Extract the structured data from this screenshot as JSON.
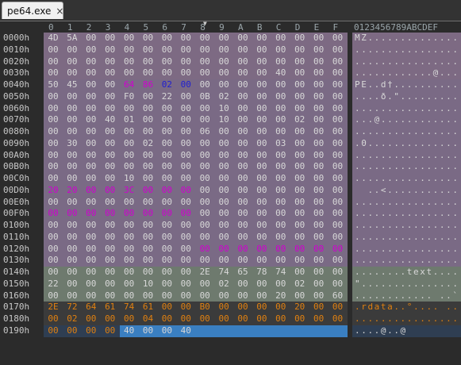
{
  "tab": {
    "title": "pe64.exe",
    "close_glyph": "×"
  },
  "column_headers": [
    "0",
    "1",
    "2",
    "3",
    "4",
    "5",
    "6",
    "7",
    "8",
    "9",
    "A",
    "B",
    "C",
    "D",
    "E",
    "F"
  ],
  "ascii_header": "0123456789ABCDEF",
  "marker_glyph": "▼",
  "offsets": [
    "0000h",
    "0010h",
    "0020h",
    "0030h",
    "0040h",
    "0050h",
    "0060h",
    "0070h",
    "0080h",
    "0090h",
    "00A0h",
    "00B0h",
    "00C0h",
    "00D0h",
    "00E0h",
    "00F0h",
    "0100h",
    "0110h",
    "0120h",
    "0130h",
    "0140h",
    "0150h",
    "0160h",
    "0170h",
    "0180h",
    "0190h"
  ],
  "rows": [
    [
      "4D",
      "5A",
      "00",
      "00",
      "00",
      "00",
      "00",
      "00",
      "00",
      "00",
      "00",
      "00",
      "00",
      "00",
      "00",
      "00"
    ],
    [
      "00",
      "00",
      "00",
      "00",
      "00",
      "00",
      "00",
      "00",
      "00",
      "00",
      "00",
      "00",
      "00",
      "00",
      "00",
      "00"
    ],
    [
      "00",
      "00",
      "00",
      "00",
      "00",
      "00",
      "00",
      "00",
      "00",
      "00",
      "00",
      "00",
      "00",
      "00",
      "00",
      "00"
    ],
    [
      "00",
      "00",
      "00",
      "00",
      "00",
      "00",
      "00",
      "00",
      "00",
      "00",
      "00",
      "00",
      "40",
      "00",
      "00",
      "00"
    ],
    [
      "50",
      "45",
      "00",
      "00",
      "64",
      "86",
      "02",
      "00",
      "00",
      "00",
      "00",
      "00",
      "00",
      "00",
      "00",
      "00"
    ],
    [
      "00",
      "00",
      "00",
      "00",
      "F0",
      "00",
      "22",
      "00",
      "0B",
      "02",
      "00",
      "00",
      "00",
      "00",
      "00",
      "00"
    ],
    [
      "00",
      "00",
      "00",
      "00",
      "00",
      "00",
      "00",
      "00",
      "00",
      "10",
      "00",
      "00",
      "00",
      "00",
      "00",
      "00"
    ],
    [
      "00",
      "00",
      "00",
      "40",
      "01",
      "00",
      "00",
      "00",
      "00",
      "10",
      "00",
      "00",
      "00",
      "02",
      "00",
      "00"
    ],
    [
      "00",
      "00",
      "00",
      "00",
      "00",
      "00",
      "00",
      "00",
      "06",
      "00",
      "00",
      "00",
      "00",
      "00",
      "00",
      "00"
    ],
    [
      "00",
      "30",
      "00",
      "00",
      "00",
      "02",
      "00",
      "00",
      "00",
      "00",
      "00",
      "00",
      "03",
      "00",
      "00",
      "00"
    ],
    [
      "00",
      "00",
      "00",
      "00",
      "00",
      "00",
      "00",
      "00",
      "00",
      "00",
      "00",
      "00",
      "00",
      "00",
      "00",
      "00"
    ],
    [
      "00",
      "00",
      "00",
      "00",
      "00",
      "00",
      "00",
      "00",
      "00",
      "00",
      "00",
      "00",
      "00",
      "00",
      "00",
      "00"
    ],
    [
      "00",
      "00",
      "00",
      "00",
      "10",
      "00",
      "00",
      "00",
      "00",
      "00",
      "00",
      "00",
      "00",
      "00",
      "00",
      "00"
    ],
    [
      "20",
      "20",
      "00",
      "00",
      "3C",
      "00",
      "00",
      "00",
      "00",
      "00",
      "00",
      "00",
      "00",
      "00",
      "00",
      "00"
    ],
    [
      "00",
      "00",
      "00",
      "00",
      "00",
      "00",
      "00",
      "00",
      "00",
      "00",
      "00",
      "00",
      "00",
      "00",
      "00",
      "00"
    ],
    [
      "00",
      "00",
      "00",
      "00",
      "00",
      "00",
      "00",
      "00",
      "00",
      "00",
      "00",
      "00",
      "00",
      "00",
      "00",
      "00"
    ],
    [
      "00",
      "00",
      "00",
      "00",
      "00",
      "00",
      "00",
      "00",
      "00",
      "00",
      "00",
      "00",
      "00",
      "00",
      "00",
      "00"
    ],
    [
      "00",
      "00",
      "00",
      "00",
      "00",
      "00",
      "00",
      "00",
      "00",
      "00",
      "00",
      "00",
      "00",
      "00",
      "00",
      "00"
    ],
    [
      "00",
      "00",
      "00",
      "00",
      "00",
      "00",
      "00",
      "00",
      "00",
      "00",
      "00",
      "00",
      "00",
      "00",
      "00",
      "00"
    ],
    [
      "00",
      "00",
      "00",
      "00",
      "00",
      "00",
      "00",
      "00",
      "00",
      "00",
      "00",
      "00",
      "00",
      "00",
      "00",
      "00"
    ],
    [
      "00",
      "00",
      "00",
      "00",
      "00",
      "00",
      "00",
      "00",
      "2E",
      "74",
      "65",
      "78",
      "74",
      "00",
      "00",
      "00"
    ],
    [
      "22",
      "00",
      "00",
      "00",
      "00",
      "10",
      "00",
      "00",
      "00",
      "02",
      "00",
      "00",
      "00",
      "02",
      "00",
      "00"
    ],
    [
      "00",
      "00",
      "00",
      "00",
      "00",
      "00",
      "00",
      "00",
      "00",
      "00",
      "00",
      "00",
      "20",
      "00",
      "00",
      "60"
    ],
    [
      "2E",
      "72",
      "64",
      "61",
      "74",
      "61",
      "00",
      "00",
      "B0",
      "00",
      "00",
      "00",
      "00",
      "20",
      "00",
      "00"
    ],
    [
      "00",
      "02",
      "00",
      "00",
      "00",
      "04",
      "00",
      "00",
      "00",
      "00",
      "00",
      "00",
      "00",
      "00",
      "00",
      "00"
    ],
    [
      "00",
      "00",
      "00",
      "00",
      "40",
      "00",
      "00",
      "40",
      "",
      "",
      "",
      "",
      "",
      "",
      "",
      ""
    ]
  ],
  "ascii": [
    "MZ..............",
    "................",
    "................",
    "............@...",
    "PE..d†..........",
    "....ð.\"..........",
    "................",
    "...@............",
    "................",
    ".0..............",
    "................",
    "................",
    "................",
    "  ..<...........",
    "................",
    "................",
    "................",
    "................",
    "................",
    "................",
    "........text....",
    "\"...............",
    "............ ..`",
    ".rdata..°.... ..",
    "................",
    "....@..@"
  ],
  "colors": {
    "dos_header": "#7d6a83",
    "pe_header": "#7a6a85",
    "section_text": "#6e7a6e",
    "section_rdata": "#3b3b3b",
    "tail": "#2f3e52",
    "text_default": "#d8d8d8",
    "text_magenta": "#d000d0",
    "text_blue": "#2020d0",
    "text_orange": "#e08010",
    "selection": "#3a7fc1"
  }
}
